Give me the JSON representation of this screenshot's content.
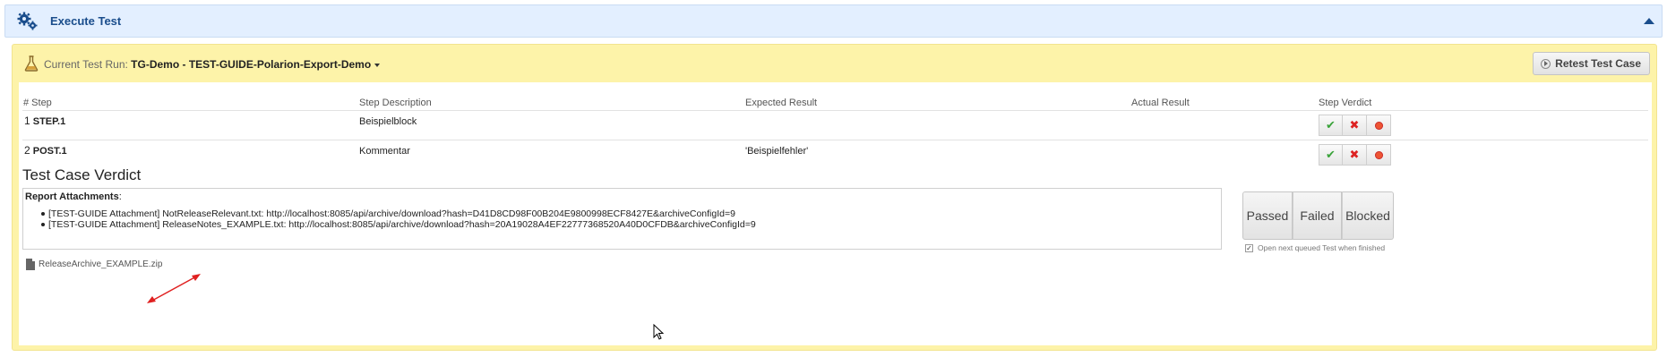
{
  "header": {
    "title": "Execute Test"
  },
  "run_bar": {
    "label": "Current Test Run: ",
    "run_name": "TG-Demo - TEST-GUIDE-Polarion-Export-Demo",
    "retest_label": "Retest Test Case"
  },
  "table": {
    "headers": {
      "step": "# Step",
      "description": "Step Description",
      "expected": "Expected Result",
      "actual": "Actual Result",
      "verdict": "Step Verdict"
    },
    "rows": [
      {
        "num": "1",
        "name": "STEP.1",
        "description": "Beispielblock",
        "expected": "",
        "actual": ""
      },
      {
        "num": "2",
        "name": "POST.1",
        "description": "Kommentar",
        "expected": "'Beispielfehler'",
        "actual": ""
      }
    ]
  },
  "verdict": {
    "title": "Test Case Verdict",
    "report_attachments_label": "Report Attachments",
    "report_attachments_colon": ":",
    "attachments": [
      "[TEST-GUIDE Attachment] NotReleaseRelevant.txt: http://localhost:8085/api/archive/download?hash=D41D8CD98F00B204E9800998ECF8427E&archiveConfigId=9",
      "[TEST-GUIDE Attachment] ReleaseNotes_EXAMPLE.txt: http://localhost:8085/api/archive/download?hash=20A19028A4EF22777368520A40D0CFDB&archiveConfigId=9"
    ],
    "archive_file": "ReleaseArchive_EXAMPLE.zip",
    "buttons": {
      "passed": "Passed",
      "failed": "Failed",
      "blocked": "Blocked"
    },
    "next_queued_label": "Open next queued Test when finished"
  },
  "colors": {
    "header_bg": "#e3efff",
    "panel_bg": "#fdf3a9",
    "title_blue": "#1a4d8c",
    "pass_green": "#3aa33a",
    "fail_red": "#dd2222",
    "annotation_arrow": "#e02020"
  },
  "icons": {
    "header": "gears-icon",
    "run": "flask-icon",
    "retest": "play-circle-icon",
    "pass": "check-icon",
    "fail": "x-icon",
    "blocked": "record-dot-icon",
    "file": "file-icon",
    "collapse": "caret-up-icon"
  }
}
